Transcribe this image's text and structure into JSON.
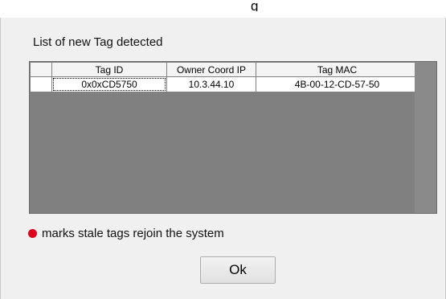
{
  "window": {
    "title_fragment": "g"
  },
  "dialog": {
    "heading": "List of new Tag detected",
    "table": {
      "columns": [
        "",
        "Tag ID",
        "Owner Coord IP",
        "Tag MAC"
      ],
      "rows": [
        {
          "tag_id": "0x0xCD5750",
          "owner_coord_ip": "10.3.44.10",
          "tag_mac": "4B-00-12-CD-57-50"
        }
      ]
    },
    "legend": {
      "text": "marks stale tags rejoin the system",
      "marker_color": "#e0001b"
    },
    "ok_label": "Ok"
  }
}
